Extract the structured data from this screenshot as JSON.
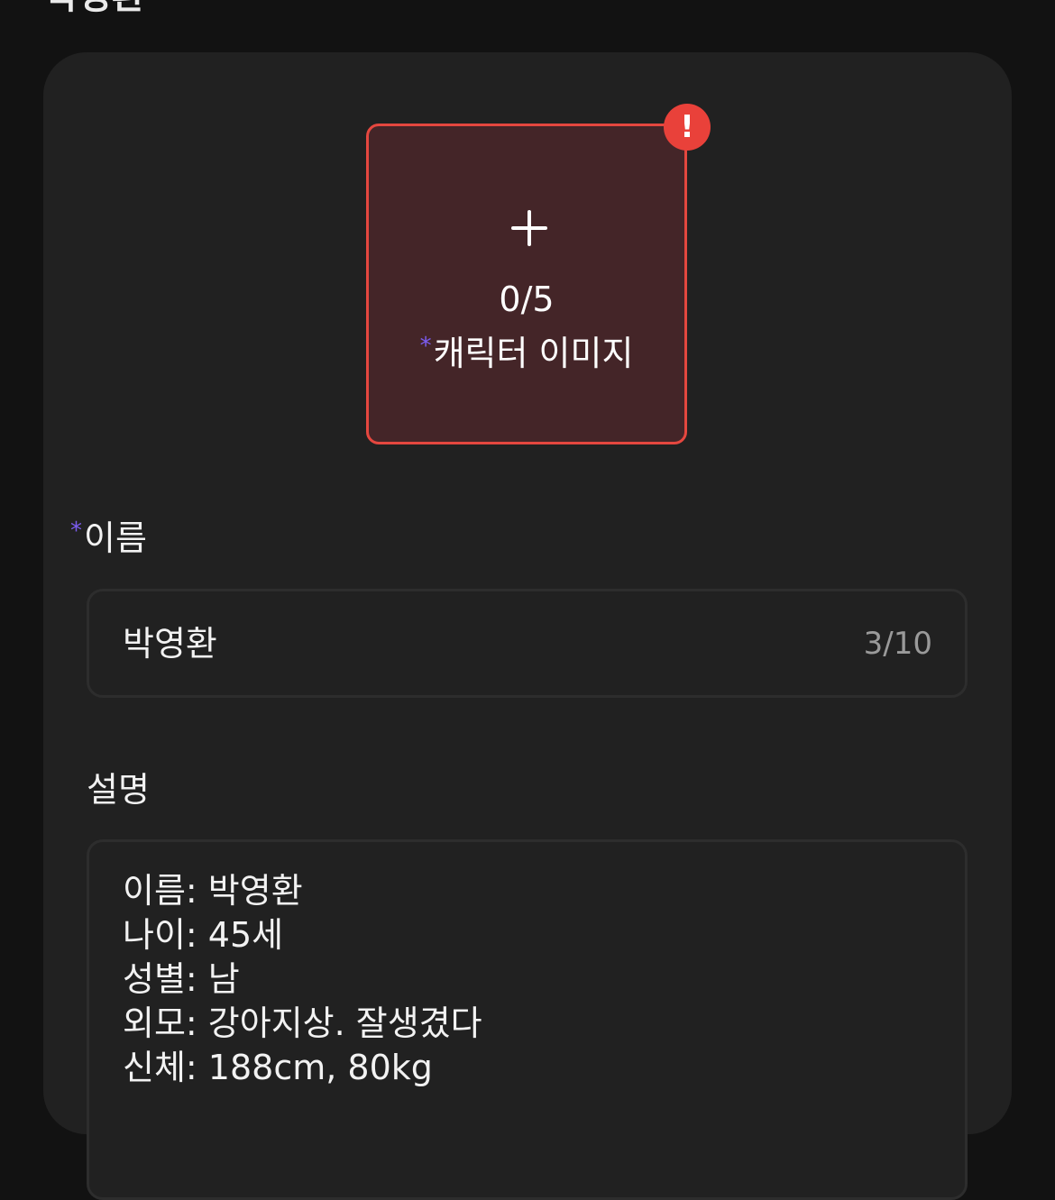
{
  "header": {
    "title": "박영환"
  },
  "image_upload": {
    "count": "0/5",
    "required_mark": "*",
    "label": "캐릭터 이미지",
    "error_mark": "!"
  },
  "name_field": {
    "required_mark": "*",
    "label": "이름",
    "value": "박영환",
    "counter": "3/10"
  },
  "description_field": {
    "label": "설명",
    "lines": [
      "이름: 박영환",
      "나이: 45세",
      "성별: 남",
      "외모: 강아지상. 잘생겼다",
      "신체: 188cm, 80kg"
    ]
  },
  "colors": {
    "background": "#121212",
    "card": "#212121",
    "error": "#e9413a",
    "required_accent": "#7b5cf0"
  }
}
